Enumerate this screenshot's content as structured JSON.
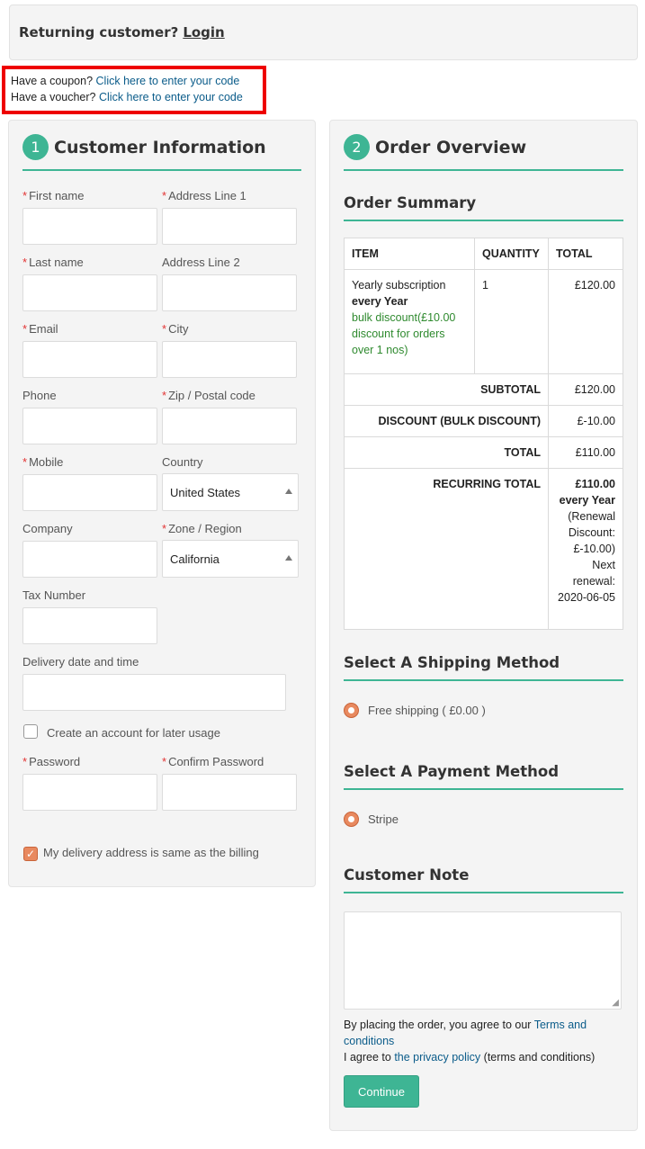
{
  "returning": {
    "text": "Returning customer?",
    "login": "Login"
  },
  "codes": {
    "coupon_q": "Have a coupon?",
    "coupon_link": "Click here to enter your code",
    "voucher_q": "Have a voucher?",
    "voucher_link": "Click here to enter your code"
  },
  "customer": {
    "step": "1",
    "title": "Customer Information",
    "labels": {
      "first_name": "First name",
      "address1": "Address Line 1",
      "last_name": "Last name",
      "address2": "Address Line 2",
      "email": "Email",
      "city": "City",
      "phone": "Phone",
      "zip": "Zip / Postal code",
      "mobile": "Mobile",
      "country": "Country",
      "company": "Company",
      "zone": "Zone / Region",
      "tax": "Tax Number",
      "delivery": "Delivery date and time",
      "password": "Password",
      "confirm": "Confirm Password"
    },
    "required_mark": "*",
    "country_value": "United States",
    "zone_value": "California",
    "create_account": "Create an account for later usage",
    "same_address": "My delivery address is same as the billing",
    "check_mark": "✓"
  },
  "order": {
    "step": "2",
    "title": "Order Overview",
    "summary_title": "Order Summary",
    "headers": {
      "item": "ITEM",
      "quantity": "QUANTITY",
      "total": "TOTAL"
    },
    "item": {
      "name": "Yearly subscription",
      "period": "every Year",
      "discount": "bulk discount(£10.00 discount for orders over 1 nos)",
      "quantity": "1",
      "total": "£120.00"
    },
    "totals": {
      "subtotal_label": "SUBTOTAL",
      "subtotal": "£120.00",
      "discount_label": "DISCOUNT (BULK DISCOUNT)",
      "discount": "£-10.00",
      "total_label": "TOTAL",
      "total": "£110.00",
      "recurring_label": "RECURRING TOTAL",
      "recurring_amount": "£110.00",
      "recurring_period": "every Year",
      "recurring_note": "(Renewal Discount: £-10.00) Next renewal: 2020-06-05"
    },
    "shipping_title": "Select A Shipping Method",
    "shipping_option": "Free shipping ( £0.00 )",
    "payment_title": "Select A Payment Method",
    "payment_option": "Stripe",
    "note_title": "Customer Note",
    "grip": "◢",
    "agree_prefix": "By placing the order, you agree to our",
    "terms_link": "Terms and conditions",
    "privacy_prefix": "I agree to",
    "privacy_link": "the privacy policy",
    "privacy_suffix": "(terms and conditions)",
    "button": "Continue"
  }
}
